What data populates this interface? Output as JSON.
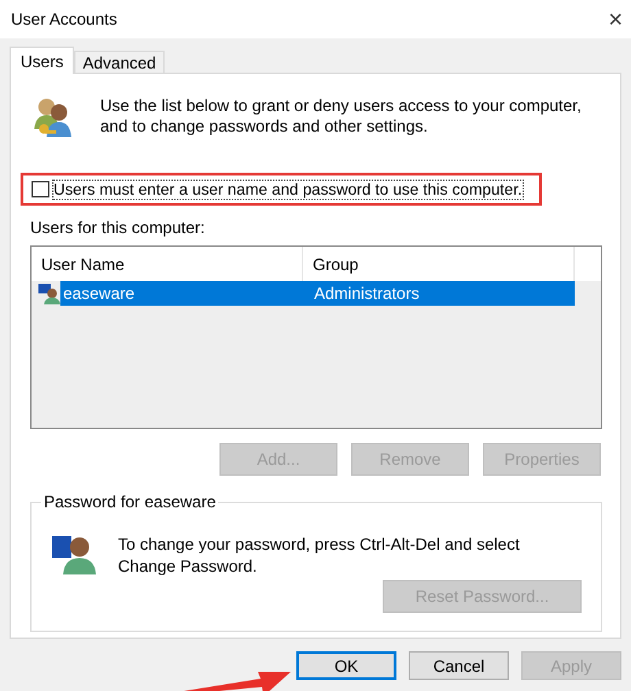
{
  "window": {
    "title": "User Accounts",
    "close": "×"
  },
  "tabs": [
    {
      "label": "Users",
      "selected": true
    },
    {
      "label": "Advanced",
      "selected": false
    }
  ],
  "intro": "Use the list below to grant or deny users access to your computer, and to change passwords and other settings.",
  "require_login": {
    "label": "Users must enter a user name and password to use this computer.",
    "checked": false
  },
  "users_label": "Users for this computer:",
  "table": {
    "columns": [
      "User Name",
      "Group"
    ],
    "rows": [
      {
        "cells": [
          "easeware",
          "Administrators"
        ],
        "selected": true
      }
    ]
  },
  "list_buttons": [
    {
      "label": "Add...",
      "disabled": true
    },
    {
      "label": "Remove",
      "disabled": true
    },
    {
      "label": "Properties",
      "disabled": true
    }
  ],
  "password_group": {
    "title": "Password for easeware",
    "text": "To change your password, press Ctrl-Alt-Del and select Change Password.",
    "button": {
      "label": "Reset Password...",
      "disabled": true
    }
  },
  "dialog_buttons": [
    {
      "label": "OK",
      "disabled": false,
      "default": true
    },
    {
      "label": "Cancel",
      "disabled": false,
      "default": false
    },
    {
      "label": "Apply",
      "disabled": true,
      "default": false
    }
  ]
}
